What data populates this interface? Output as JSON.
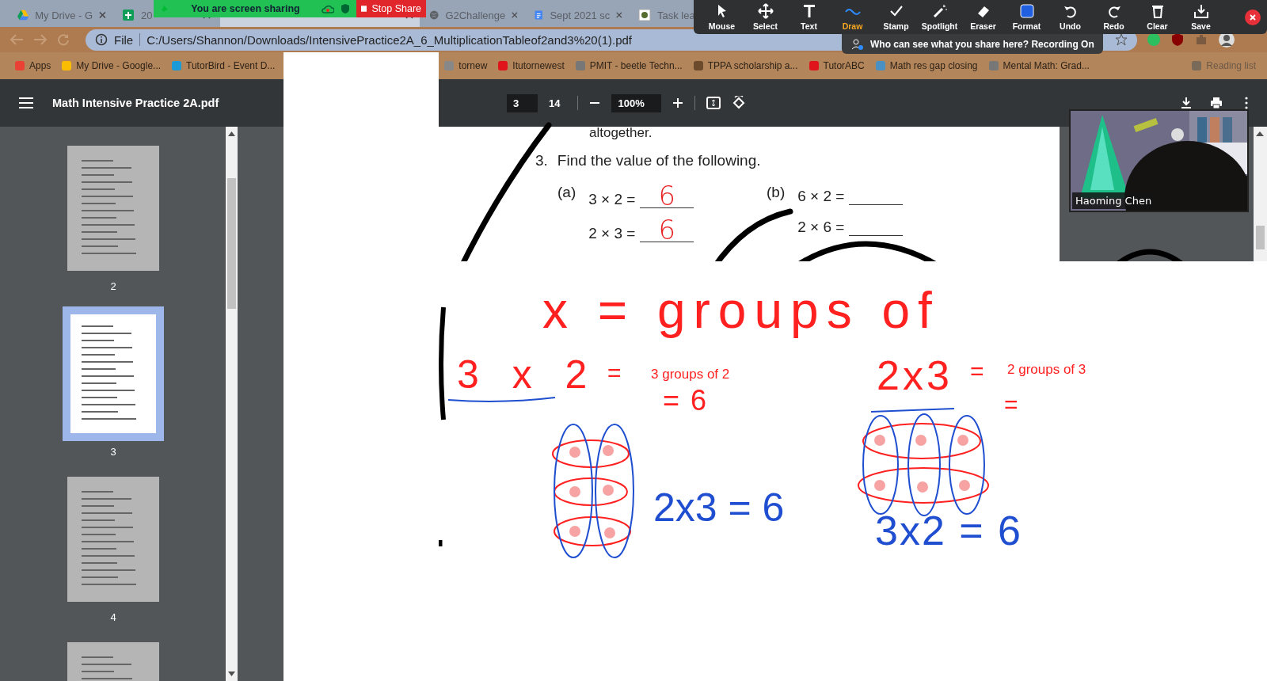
{
  "browser": {
    "tabs": [
      {
        "title": "My Drive - G",
        "selected": false
      },
      {
        "title": "20",
        "selected": false
      },
      {
        "selected": true
      },
      {
        "title": "G2Challenge",
        "selected": false
      },
      {
        "title": "Sept 2021 sc",
        "selected": false
      },
      {
        "title": "Task lea",
        "selected": false
      }
    ],
    "address": {
      "scheme": "File",
      "url": "C:/Users/Shannon/Downloads/IntensivePractice2A_6_MultiplicationTableof2and3%20(1).pdf"
    },
    "bookmarks": [
      {
        "label": "Apps"
      },
      {
        "label": "My Drive - Google..."
      },
      {
        "label": "TutorBird - Event D..."
      },
      {
        "label": "tornew"
      },
      {
        "label": "Itutornewest"
      },
      {
        "label": "PMIT - beetle Techn..."
      },
      {
        "label": "TPPA scholarship a..."
      },
      {
        "label": "TutorABC"
      },
      {
        "label": "Math res gap closing"
      },
      {
        "label": "Mental Math: Grad..."
      },
      {
        "label": "Reading list"
      }
    ]
  },
  "screen_share": {
    "status": "You are screen sharing",
    "stop": "Stop Share",
    "tools": [
      {
        "label": "Mouse",
        "selected": false
      },
      {
        "label": "Select",
        "selected": false
      },
      {
        "label": "Text",
        "selected": false
      },
      {
        "label": "Draw",
        "selected": true
      },
      {
        "label": "Stamp",
        "selected": false
      },
      {
        "label": "Spotlight",
        "selected": false
      },
      {
        "label": "Eraser",
        "selected": false
      },
      {
        "label": "Format",
        "selected": false
      },
      {
        "label": "Undo",
        "selected": false
      },
      {
        "label": "Redo",
        "selected": false
      },
      {
        "label": "Clear",
        "selected": false
      },
      {
        "label": "Save",
        "selected": false
      }
    ],
    "notice": "Who can see what you share here? Recording On"
  },
  "pdf_viewer": {
    "title": "Math Intensive Practice 2A.pdf",
    "page": "3",
    "page_count": "14",
    "zoom": "100%",
    "thumbnails": [
      {
        "label": "2",
        "selected": false
      },
      {
        "label": "3",
        "selected": true
      },
      {
        "label": "4",
        "selected": false
      },
      {
        "selected": false
      }
    ]
  },
  "page": {
    "cut_text": "altogether.",
    "question_number": "3.",
    "question": "Find the value of the following.",
    "parts": [
      {
        "label": "(a)",
        "lines": [
          {
            "expression": "3 × 2 =",
            "answer": "6"
          },
          {
            "expression": "2 × 3 =",
            "answer": "6"
          }
        ]
      },
      {
        "label": "(b)",
        "lines": [
          {
            "expression": "6 × 2 ="
          },
          {
            "expression": "2 × 6 ="
          }
        ]
      }
    ]
  },
  "video": {
    "name": "Haoming Chen"
  },
  "whiteboard": {
    "notes": [
      {
        "text": "x = groups of",
        "color": "#ff2020"
      },
      {
        "text": "3 x 2",
        "color": "#ff2020"
      },
      {
        "text": "=",
        "color": "#ff2020"
      },
      {
        "text": "3 groups of 2",
        "color": "#ff2020"
      },
      {
        "text": "= 6",
        "color": "#ff2020"
      },
      {
        "text": "2x3",
        "color": "#ff2020"
      },
      {
        "text": "=",
        "color": "#ff2020"
      },
      {
        "text": "2 groups of 3",
        "color": "#ff2020"
      },
      {
        "text": "=",
        "color": "#ff2020"
      },
      {
        "text": "2x3 = 6",
        "color": "#1f4fd0"
      },
      {
        "text": "3x2 = 6",
        "color": "#1f4fd0"
      }
    ]
  }
}
